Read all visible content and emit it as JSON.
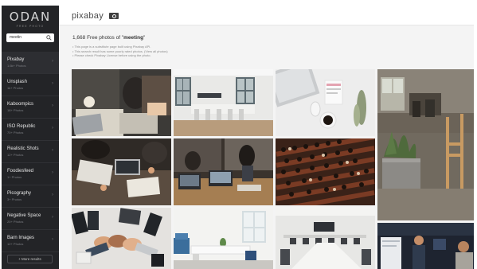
{
  "sidebar": {
    "brand": "ODAN",
    "brand_sub": "FREE PHOTO",
    "search_value": "meetin",
    "items": [
      {
        "label": "Pixabay",
        "count": "1.6k+ Photos"
      },
      {
        "label": "Unsplash",
        "count": "1k+ Photos"
      },
      {
        "label": "Kaboompics",
        "count": "18+ Photos"
      },
      {
        "label": "ISO Republic",
        "count": "70+ Photos"
      },
      {
        "label": "Realistic Shots",
        "count": "12+ Photos"
      },
      {
        "label": "Foodiesfeed",
        "count": "1+ Photos"
      },
      {
        "label": "Picography",
        "count": "3+ Photos"
      },
      {
        "label": "Negative Space",
        "count": "20+ Photos"
      },
      {
        "label": "Barn Images",
        "count": "12+ Photos"
      }
    ],
    "more_label": "+ More results"
  },
  "topbar": {
    "logo": "pixabay"
  },
  "results": {
    "count": "1,668",
    "title_mid": " Free photos of \"",
    "query": "meeting",
    "title_end": "\"",
    "notes": [
      "This page is a substitute page built using Pixabay API.",
      "This search result has some poorly rated photos. (View all photos)",
      "Please check Pixabay License before using the photo."
    ]
  },
  "colors": {
    "sidebar_bg": "#232427",
    "active_bg": "#2d2e32",
    "link": "#5b8dd6"
  },
  "photos": [
    {
      "subject": "meeting-laptops-coffee"
    },
    {
      "subject": "empty-conference-room"
    },
    {
      "subject": "desk-laptop-coffee-flatlay"
    },
    {
      "subject": "cafe-interior-plant"
    },
    {
      "subject": "team-meeting-desk"
    },
    {
      "subject": "office-work-laptops"
    },
    {
      "subject": "auditorium-crowd"
    },
    {
      "subject": "hands-phones-table"
    },
    {
      "subject": "white-meeting-room"
    },
    {
      "subject": "boardroom-table"
    },
    {
      "subject": "presenter-meeting"
    }
  ]
}
